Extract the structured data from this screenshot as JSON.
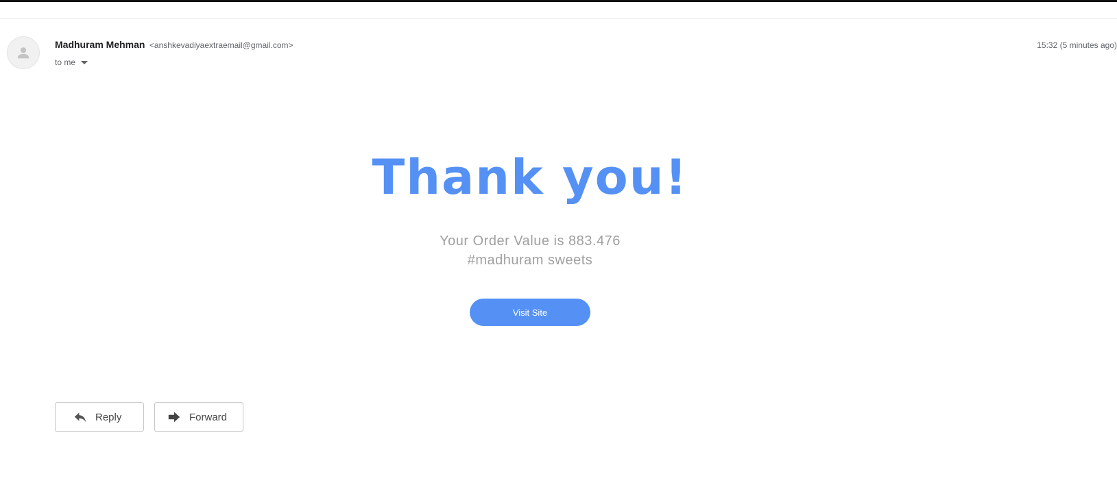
{
  "header": {
    "sender_name": "Madhuram Mehman",
    "sender_email": "<anshkevadiyaextraemail@gmail.com>",
    "timestamp": "15:32 (5 minutes ago)",
    "recipient": "to me"
  },
  "body": {
    "headline": "Thank you!",
    "order_value": "Your Order Value is 883.476",
    "store_tag": "#madhuram sweets",
    "visit_button_label": "Visit Site",
    "accent_color": "#5591f5",
    "muted_text_color": "#a0a0a0"
  },
  "actions": {
    "reply_label": "Reply",
    "forward_label": "Forward"
  },
  "icons": {
    "avatar": "person-icon",
    "recipient_toggle": "caret-down-icon",
    "reply": "reply-icon",
    "forward": "forward-icon"
  }
}
